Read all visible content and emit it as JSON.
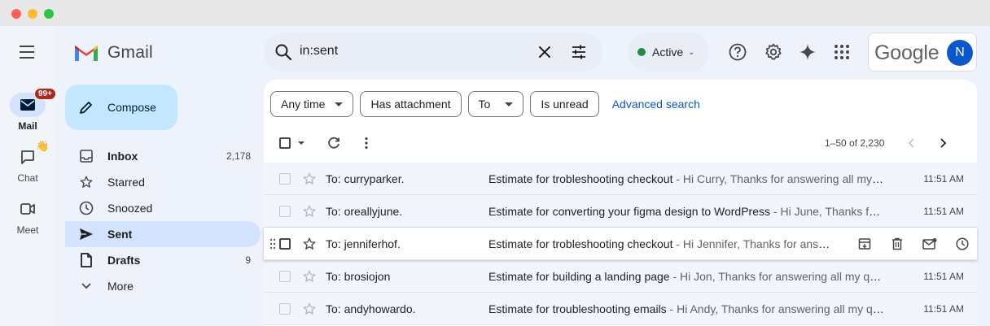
{
  "app": {
    "name": "Gmail"
  },
  "rail": {
    "items": [
      {
        "label": "Mail",
        "badge": "99+",
        "icon": "mail-icon"
      },
      {
        "label": "Chat",
        "icon": "chat-icon",
        "emoji": "👋"
      },
      {
        "label": "Meet",
        "icon": "video-icon"
      }
    ]
  },
  "compose": {
    "label": "Compose"
  },
  "nav": {
    "items": [
      {
        "label": "Inbox",
        "count": "2,178",
        "icon": "inbox-icon",
        "bold": true
      },
      {
        "label": "Starred",
        "count": "",
        "icon": "star-icon",
        "bold": false
      },
      {
        "label": "Snoozed",
        "count": "",
        "icon": "clock-icon",
        "bold": false
      },
      {
        "label": "Sent",
        "count": "",
        "icon": "send-icon",
        "bold": true,
        "active": true
      },
      {
        "label": "Drafts",
        "count": "9",
        "icon": "draft-icon",
        "bold": true
      },
      {
        "label": "More",
        "count": "",
        "icon": "chevron-down-icon",
        "bold": false
      }
    ]
  },
  "search": {
    "value": "in:sent"
  },
  "status": {
    "label": "Active",
    "color": "#1e8e3e"
  },
  "account": {
    "brand": "Google",
    "initial": "N",
    "avatar_color": "#0b57d0"
  },
  "filters": {
    "chips": [
      {
        "label": "Any time",
        "dropdown": true
      },
      {
        "label": "Has attachment",
        "dropdown": false
      },
      {
        "label": "To",
        "dropdown": true
      },
      {
        "label": "Is unread",
        "dropdown": false
      }
    ],
    "advanced": "Advanced search"
  },
  "toolbar": {
    "range": "1–50 of 2,230"
  },
  "emails": [
    {
      "to": "To: curryparker.",
      "subject": "Estimate for trobleshooting checkout",
      "snippet": " - Hi Curry, Thanks for answering all my questions",
      "time": "11:51 AM"
    },
    {
      "to": "To: oreallyjune.",
      "subject": "Estimate for converting your figma design to WordPress",
      "snippet": " - Hi June, Thanks for answering",
      "time": "11:51 AM"
    },
    {
      "to": "To: jenniferhof.",
      "subject": "Estimate for trobleshooting checkout",
      "snippet": " - Hi Jennifer, Thanks for answering",
      "time": "",
      "hover": true
    },
    {
      "to": "To: brosiojon",
      "subject": "Estimate for building a landing page",
      "snippet": " - Hi Jon, Thanks for answering all my questions",
      "time": "11:51 AM"
    },
    {
      "to": "To: andyhowardo.",
      "subject": "Estimate for troubleshooting emails",
      "snippet": " - Hi Andy, Thanks for answering all my questions",
      "time": "11:51 AM"
    }
  ],
  "row_actions": [
    "archive-icon",
    "delete-icon",
    "mark-unread-icon",
    "snooze-icon"
  ],
  "colors": {
    "accent": "#0b57d0",
    "compose_bg": "#c2e7ff",
    "active_nav": "#d3e3fd",
    "unread_badge": "#b3261e"
  }
}
